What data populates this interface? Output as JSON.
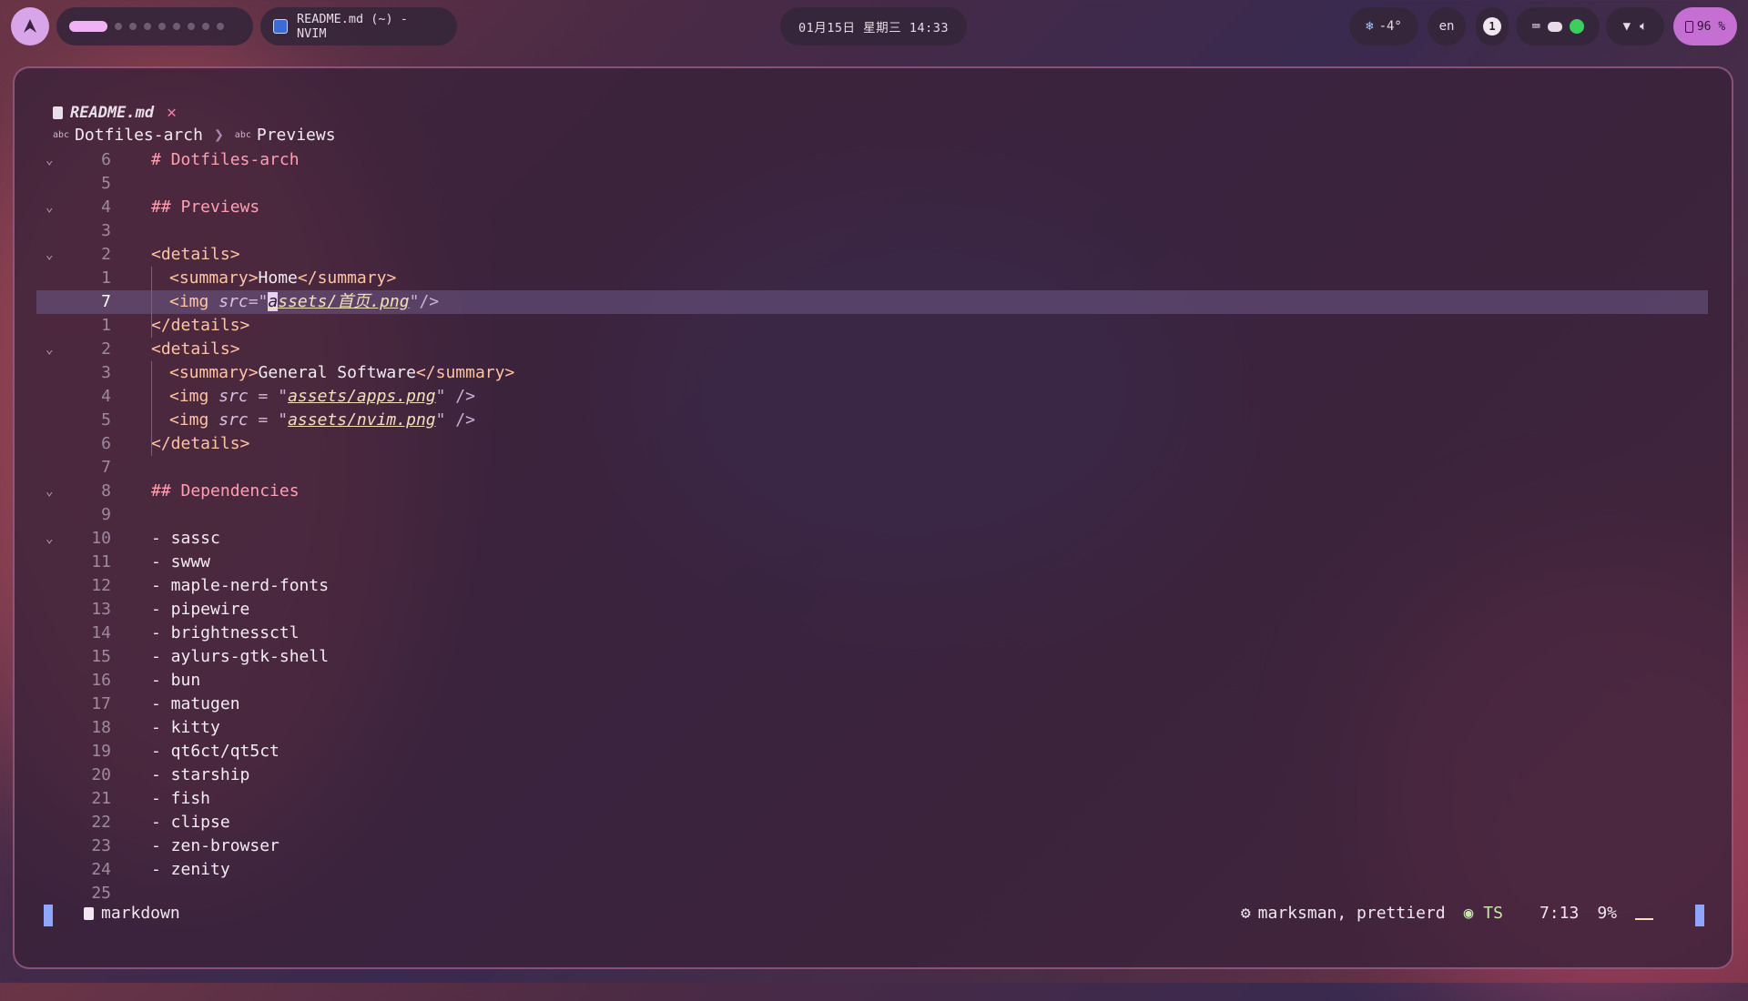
{
  "topbar": {
    "window_title": "README.md (~) - NVIM",
    "clock": "01月15日 星期三 14:33",
    "weather": "-4°",
    "lang": "en",
    "notifications": "1",
    "battery": "96 %"
  },
  "editor": {
    "tab_name": "README.md",
    "breadcrumb": [
      "Dotfiles-arch",
      "Previews"
    ],
    "lines": [
      {
        "num": "6",
        "fold": true,
        "kind": "h",
        "text": "# Dotfiles-arch"
      },
      {
        "num": "5",
        "kind": "blank",
        "text": ""
      },
      {
        "num": "4",
        "fold": true,
        "kind": "h",
        "text": "## Previews"
      },
      {
        "num": "3",
        "kind": "blank",
        "text": ""
      },
      {
        "num": "2",
        "fold": true,
        "kind": "tag",
        "text": "<details>"
      },
      {
        "num": "1",
        "kind": "summary",
        "text": "Home"
      },
      {
        "num": "7",
        "kind": "imgcur",
        "text": "assets/首页.png",
        "current": true
      },
      {
        "num": "1",
        "kind": "tag",
        "text": "</details>"
      },
      {
        "num": "2",
        "fold": true,
        "kind": "tag",
        "text": "<details>"
      },
      {
        "num": "3",
        "kind": "summary",
        "text": "General Software"
      },
      {
        "num": "4",
        "kind": "img",
        "text": "assets/apps.png"
      },
      {
        "num": "5",
        "kind": "img",
        "text": "assets/nvim.png"
      },
      {
        "num": "6",
        "kind": "tag",
        "text": "</details>"
      },
      {
        "num": "7",
        "kind": "blank",
        "text": ""
      },
      {
        "num": "8",
        "fold": true,
        "kind": "h",
        "text": "## Dependencies"
      },
      {
        "num": "9",
        "kind": "blank",
        "text": ""
      },
      {
        "num": "10",
        "fold": true,
        "kind": "plain",
        "text": "- sassc"
      },
      {
        "num": "11",
        "kind": "plain",
        "text": "- swww"
      },
      {
        "num": "12",
        "kind": "plain",
        "text": "- maple-nerd-fonts"
      },
      {
        "num": "13",
        "kind": "plain",
        "text": "- pipewire"
      },
      {
        "num": "14",
        "kind": "plain",
        "text": "- brightnessctl"
      },
      {
        "num": "15",
        "kind": "plain",
        "text": "- aylurs-gtk-shell"
      },
      {
        "num": "16",
        "kind": "plain",
        "text": "- bun"
      },
      {
        "num": "17",
        "kind": "plain",
        "text": "- matugen"
      },
      {
        "num": "18",
        "kind": "plain",
        "text": "- kitty"
      },
      {
        "num": "19",
        "kind": "plain",
        "text": "- qt6ct/qt5ct"
      },
      {
        "num": "20",
        "kind": "plain",
        "text": "- starship"
      },
      {
        "num": "21",
        "kind": "plain",
        "text": "- fish"
      },
      {
        "num": "22",
        "kind": "plain",
        "text": "- clipse"
      },
      {
        "num": "23",
        "kind": "plain",
        "text": "- zen-browser"
      },
      {
        "num": "24",
        "kind": "plain",
        "text": "- zenity"
      },
      {
        "num": "25",
        "kind": "blank",
        "text": ""
      }
    ]
  },
  "statusbar": {
    "filetype": "markdown",
    "lsp": "marksman, prettierd",
    "treesitter": "TS",
    "position": "7:13",
    "percent": "9%"
  },
  "colors": {
    "accent": "#efb3f5",
    "battery": "#c56fd3",
    "status_block": "#8fa6ff"
  }
}
